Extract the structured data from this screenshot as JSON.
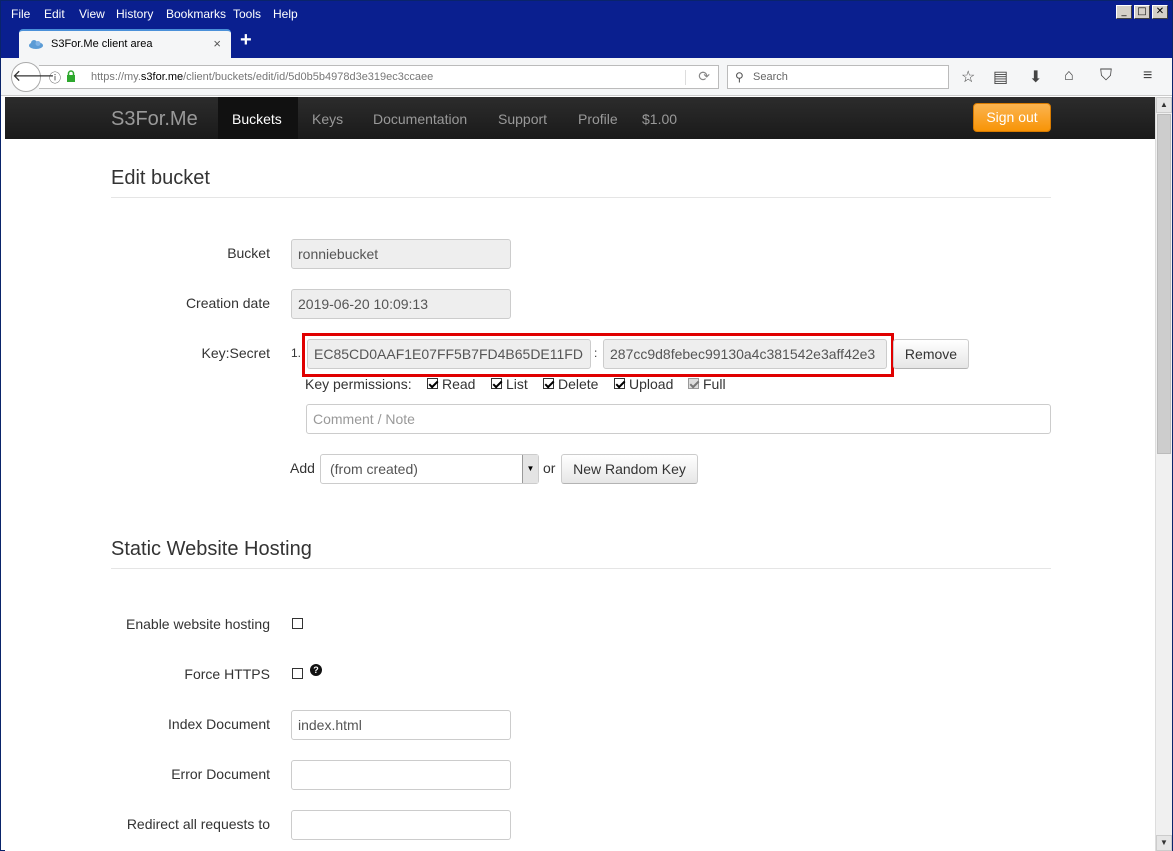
{
  "menubar": {
    "items": [
      "File",
      "Edit",
      "View",
      "History",
      "Bookmarks",
      "Tools",
      "Help"
    ],
    "window_buttons": [
      "_",
      "□",
      "✕"
    ]
  },
  "tab": {
    "title": "S3For.Me client area",
    "close": "×",
    "new_tab": "+"
  },
  "urlbar": {
    "prefix": "https://my.",
    "domain": "s3for.me",
    "path": "/client/buckets/edit/id/5d0b5b4978d3e319ec3ccaee"
  },
  "searchbar": {
    "placeholder": "Search"
  },
  "site_nav": {
    "brand": "S3For.Me",
    "links": [
      "Buckets",
      "Keys",
      "Documentation",
      "Support",
      "Profile",
      "$1.00"
    ],
    "active": "Buckets",
    "signout": "Sign out"
  },
  "edit_bucket": {
    "title": "Edit bucket",
    "bucket_label": "Bucket",
    "bucket_value": "ronniebucket",
    "creation_label": "Creation date",
    "creation_value": "2019-06-20 10:09:13",
    "keysecret_label": "Key:Secret",
    "key_index": "1.",
    "key_value": "EC85CD0AAF1E07FF5B7FD4B65DE11FD",
    "separator": ":",
    "secret_value": "287cc9d8febec99130a4c381542e3aff42e3",
    "remove_label": "Remove",
    "permissions_label": "Key permissions:",
    "permissions": [
      {
        "label": "Read",
        "checked": true,
        "disabled": false
      },
      {
        "label": "List",
        "checked": true,
        "disabled": false
      },
      {
        "label": "Delete",
        "checked": true,
        "disabled": false
      },
      {
        "label": "Upload",
        "checked": true,
        "disabled": false
      },
      {
        "label": "Full",
        "checked": true,
        "disabled": true
      }
    ],
    "comment_placeholder": "Comment / Note",
    "add_label": "Add",
    "add_select_value": "(from created)",
    "or_label": "or",
    "new_random_key_label": "New Random Key"
  },
  "hosting": {
    "title": "Static Website Hosting",
    "enable_label": "Enable website hosting",
    "force_https_label": "Force HTTPS",
    "help_icon": "?",
    "index_label": "Index Document",
    "index_value": "index.html",
    "error_label": "Error Document",
    "error_value": "",
    "redirect_label": "Redirect all requests to",
    "redirect_value": ""
  },
  "scrollbar": {
    "up": "▲",
    "down": "▼"
  }
}
